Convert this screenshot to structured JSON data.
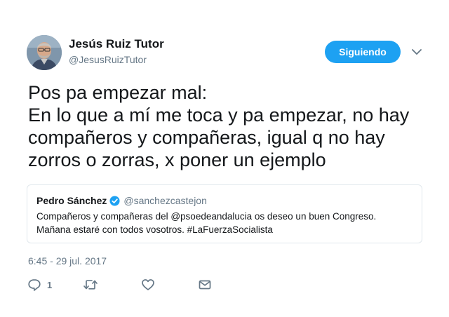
{
  "author": {
    "name": "Jesús Ruiz Tutor",
    "handle": "@JesusRuizTutor",
    "follow_label": "Siguiendo"
  },
  "tweet": {
    "lines": [
      "Pos pa empezar mal:",
      "En lo que a mí me toca y pa empezar, no hay",
      "compañeros y compañeras, igual q no hay",
      "zorros o zorras, x poner un ejemplo"
    ],
    "timestamp": "6:45 - 29 jul. 2017"
  },
  "quoted_tweet": {
    "name": "Pedro Sánchez",
    "handle": "@sanchezcastejon",
    "verified_icon": "verified-badge-icon",
    "lines": [
      "Compañeros y compañeras del @psoedeandalucia os deseo un buen Congreso.",
      "Mañana estaré con todos vosotros. #LaFuerzaSocialista"
    ]
  },
  "actions": {
    "reply_count": "1",
    "icons": [
      "reply-icon",
      "retweet-icon",
      "like-icon",
      "direct-message-icon"
    ]
  },
  "colors": {
    "accent": "#1da1f2",
    "text": "#14171a",
    "muted": "#657786",
    "border": "#e1e8ed"
  }
}
